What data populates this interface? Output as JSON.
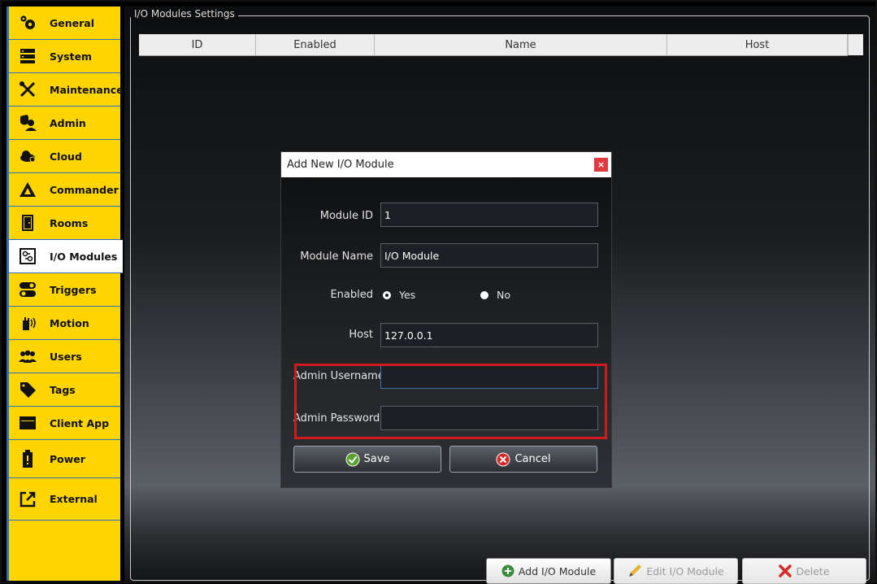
{
  "sidebar": {
    "items": [
      {
        "label": "General",
        "icon": "gears-icon"
      },
      {
        "label": "System",
        "icon": "server-icon"
      },
      {
        "label": "Maintenance",
        "icon": "tools-icon"
      },
      {
        "label": "Admin",
        "icon": "admin-shield-icon"
      },
      {
        "label": "Cloud",
        "icon": "cloud-icon"
      },
      {
        "label": "Commander",
        "icon": "commander-logo-icon"
      },
      {
        "label": "Rooms",
        "icon": "door-icon"
      },
      {
        "label": "I/O Modules",
        "icon": "io-module-icon",
        "active": true
      },
      {
        "label": "Triggers",
        "icon": "toggle-icon"
      },
      {
        "label": "Motion",
        "icon": "hand-wave-icon"
      },
      {
        "label": "Users",
        "icon": "users-icon"
      },
      {
        "label": "Tags",
        "icon": "tag-icon"
      },
      {
        "label": "Client App",
        "icon": "window-icon"
      },
      {
        "label": "Power",
        "icon": "battery-icon"
      },
      {
        "label": "External",
        "icon": "external-link-icon"
      }
    ]
  },
  "main": {
    "group_title": "I/O Modules Settings",
    "table": {
      "columns": [
        "ID",
        "Enabled",
        "Name",
        "Host"
      ]
    },
    "buttons": {
      "add": "Add I/O Module",
      "edit": "Edit I/O Module",
      "delete": "Delete"
    }
  },
  "dialog": {
    "title": "Add New I/O Module",
    "close": "×",
    "module_id_label": "Module ID",
    "module_id_value": "1",
    "module_name_label": "Module Name",
    "module_name_value": "I/O Module",
    "enabled_label": "Enabled",
    "enabled_yes": "Yes",
    "enabled_no": "No",
    "enabled_selected": "Yes",
    "host_label": "Host",
    "host_value": "127.0.0.1",
    "admin_username_label": "Admin Username",
    "admin_username_value": "",
    "admin_password_label": "Admin Password",
    "admin_password_value": "",
    "save": "Save",
    "cancel": "Cancel"
  },
  "colors": {
    "sidebar_bg": "#ffd500",
    "sidebar_divider": "#2e6fbf",
    "highlight": "#d11a1a",
    "close_red": "#e0393e"
  }
}
